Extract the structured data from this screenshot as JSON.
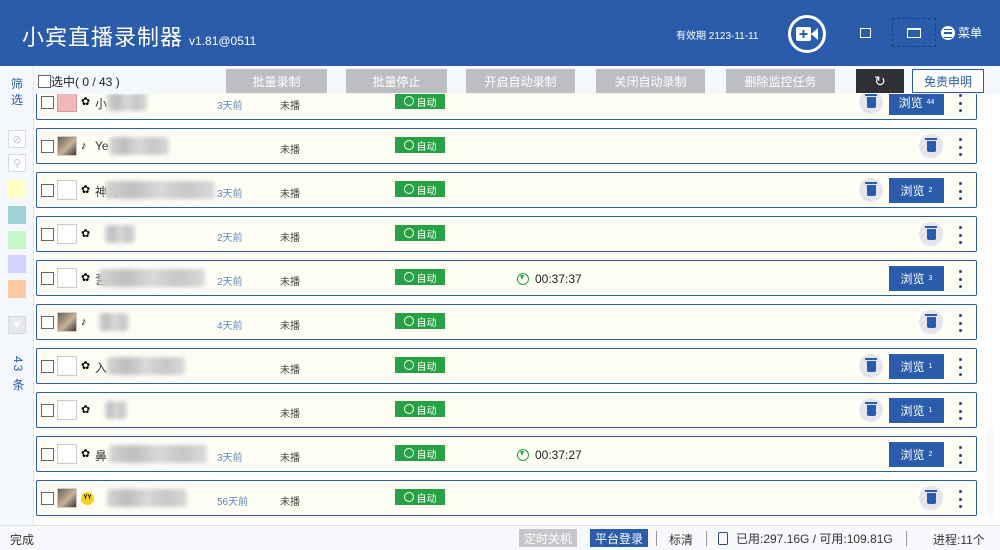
{
  "header": {
    "title": "小宾直播录制器",
    "version": "v1.81@0511",
    "validity": "有效期 2123-11-11",
    "menu_label": "菜单"
  },
  "sidebar": {
    "filter_label": "筛选",
    "count_label": "43 条",
    "swatch_colors": [
      "#fdfdc4",
      "#9fd3d3",
      "#c6f7c6",
      "#d4d0ff",
      "#fcc9a0"
    ]
  },
  "toolbar": {
    "select_label": "选中( 0  /  43 )",
    "buttons": [
      "批量录制",
      "批量停止",
      "开启自动录制",
      "关闭自动录制",
      "删除监控任务"
    ],
    "refresh_icon": "↻",
    "disclaimer": "免责申明"
  },
  "rows": [
    {
      "name": "小",
      "time_ago": "3天前",
      "status": "未播",
      "auto": "自动",
      "rec_time": "",
      "browse": "浏览",
      "browse_count": "44",
      "avatar": "pink-avatar",
      "platform": "fan-icon"
    },
    {
      "name": "Ye",
      "time_ago": "",
      "status": "未播",
      "auto": "自动",
      "rec_time": "",
      "browse": "",
      "browse_count": "",
      "avatar": "photo-avatar",
      "platform": "tiktok-icon"
    },
    {
      "name": "神先",
      "time_ago": "3天前",
      "status": "未播",
      "auto": "自动",
      "rec_time": "",
      "browse": "浏览",
      "browse_count": "2",
      "avatar": "blank-avatar",
      "platform": "fan-icon"
    },
    {
      "name": "",
      "time_ago": "2天前",
      "status": "未播",
      "auto": "自动",
      "rec_time": "",
      "browse": "",
      "browse_count": "",
      "avatar": "blank-avatar",
      "platform": "fan-icon"
    },
    {
      "name": "乭",
      "time_ago": "2天前",
      "status": "未播",
      "auto": "自动",
      "rec_time": "00:37:37",
      "browse": "浏览",
      "browse_count": "3",
      "avatar": "blank-avatar",
      "platform": "fan-icon"
    },
    {
      "name": "",
      "time_ago": "4天前",
      "status": "未播",
      "auto": "自动",
      "rec_time": "",
      "browse": "",
      "browse_count": "",
      "avatar": "photo-avatar",
      "platform": "tiktok-icon"
    },
    {
      "name": "入",
      "time_ago": "",
      "status": "未播",
      "auto": "自动",
      "rec_time": "",
      "browse": "浏览",
      "browse_count": "1",
      "avatar": "blank-avatar",
      "platform": "fan-icon"
    },
    {
      "name": "",
      "time_ago": "",
      "status": "未播",
      "auto": "自动",
      "rec_time": "",
      "browse": "浏览",
      "browse_count": "1",
      "avatar": "blank-avatar",
      "platform": "fan-icon"
    },
    {
      "name": "鼻",
      "time_ago": "3天前",
      "status": "未播",
      "auto": "自动",
      "rec_time": "00:37:27",
      "browse": "浏览",
      "browse_count": "2",
      "avatar": "blank-avatar",
      "platform": "fan-icon"
    },
    {
      "name": "",
      "time_ago": "56天前",
      "status": "未播",
      "auto": "自动",
      "rec_time": "",
      "browse": "",
      "browse_count": "",
      "avatar": "photo-avatar",
      "platform": "yy-icon"
    }
  ],
  "statusbar": {
    "done": "完成",
    "timer_shutdown": "定时关机",
    "platform_login": "平台登录",
    "quality": "标清",
    "disk": "已用:297.16G / 可用:109.81G",
    "processes": "进程:11个"
  },
  "colors": {
    "primary": "#2b5cab",
    "auto_green": "#25a244",
    "row_bg": "#fefef5"
  }
}
